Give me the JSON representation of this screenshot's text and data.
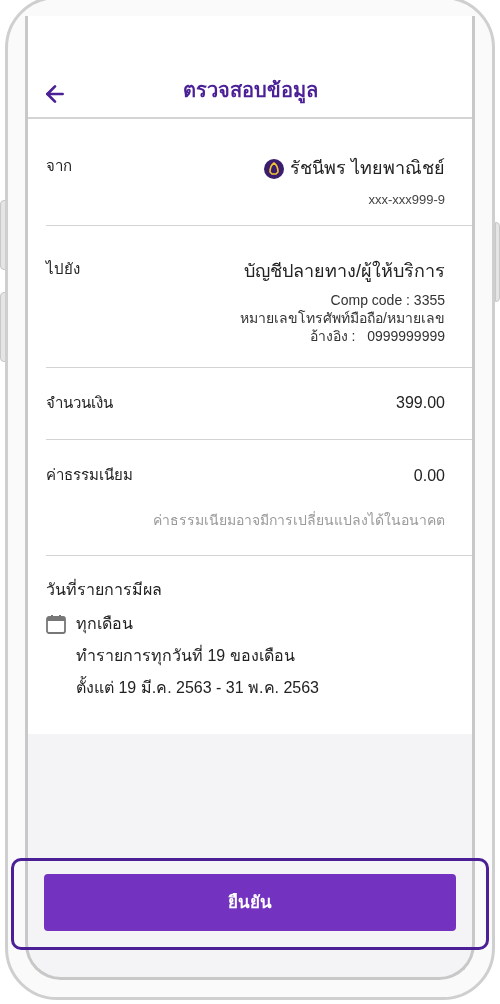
{
  "header": {
    "title": "ตรวจสอบข้อมูล"
  },
  "from": {
    "label": "จาก",
    "name": "รัชนีพร ไทยพาณิชย์",
    "account": "xxx-xxx999-9"
  },
  "to": {
    "label": "ไปยัง",
    "name": "บัญชีปลายทาง/ผู้ให้บริการ",
    "details": [
      "Comp code : 3355",
      "หมายเลขโทรศัพท์มือถือ/หมายเลข",
      "อ้างอิง :   0999999999"
    ]
  },
  "amount": {
    "label": "จำนวนเงิน",
    "value": "399.00"
  },
  "fee": {
    "label": "ค่าธรรมเนียม",
    "value": "0.00",
    "note": "ค่าธรรมเนียมอาจมีการเปลี่ยนแปลงได้ในอนาคต"
  },
  "effective_date": {
    "label": "วันที่รายการมีผล",
    "frequency": "ทุกเดือน",
    "lines": [
      "ทำรายการทุกวันที่ 19 ของเดือน",
      "ตั้งแต่ 19 มี.ค. 2563 - 31 พ.ค. 2563"
    ]
  },
  "confirm_button": {
    "label": "ยืนยัน"
  }
}
